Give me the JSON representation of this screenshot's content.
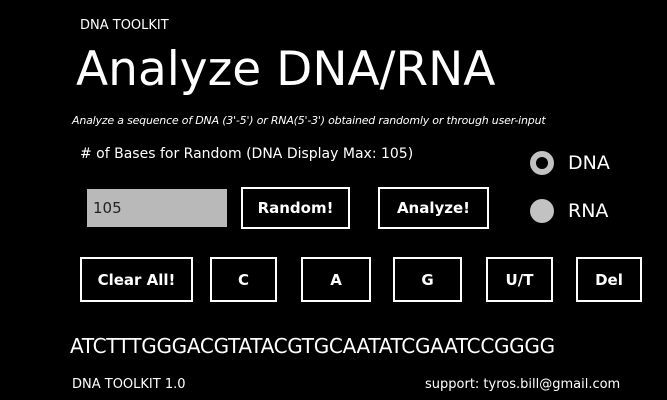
{
  "header": {
    "app_name": "DNA TOOLKIT",
    "title": "Analyze DNA/RNA",
    "subtitle": "Analyze a sequence of DNA (3'-5') or RNA(5'-3') obtained randomly or through user-input"
  },
  "controls": {
    "bases_label": "# of Bases for Random (DNA Display Max: 105)",
    "bases_value": "105",
    "random_label": "Random!",
    "analyze_label": "Analyze!"
  },
  "radio": {
    "dna_label": "DNA",
    "rna_label": "RNA",
    "selected": "DNA"
  },
  "bases_buttons": {
    "clear_label": "Clear All!",
    "c_label": "C",
    "a_label": "A",
    "g_label": "G",
    "ut_label": "U/T",
    "del_label": "Del"
  },
  "sequence": "ATCTTTGGGACGTATACGTGCAATATCGAATCCGGGG",
  "footer": {
    "version": "DNA TOOLKIT 1.0",
    "support": "support: tyros.bill@gmail.com"
  },
  "colors": {
    "background": "#000000",
    "foreground": "#ffffff",
    "input_bg": "#b9b9b9",
    "radio": "#c2c2c2"
  }
}
